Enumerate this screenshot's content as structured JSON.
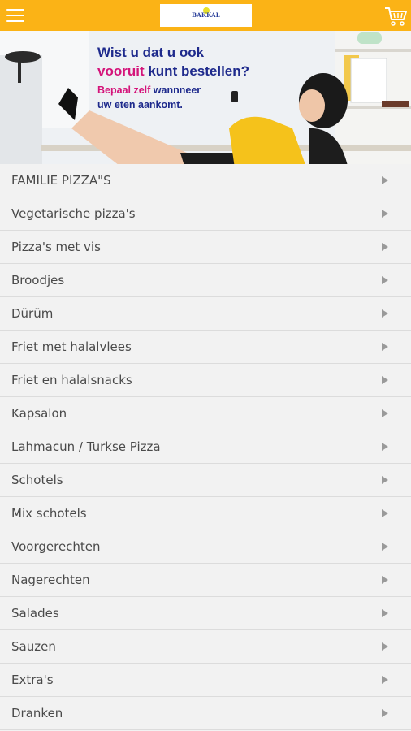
{
  "header": {
    "menu_icon": "hamburger-menu-icon",
    "logo_text": "BAKKAL",
    "cart_icon": "shopping-cart-icon",
    "background_color": "#fbb316"
  },
  "banner": {
    "line1": "Wist u dat u ook",
    "line2_part1": "vooruit",
    "line2_part2": "kunt bestellen?",
    "line3_part1": "Bepaal zelf",
    "line3_part2": "wannneer",
    "line4": "uw eten aankomt.",
    "accent_pink": "#d4147a",
    "accent_blue": "#1e2a8c"
  },
  "categories": [
    "FAMILIE PIZZA\"S",
    "Vegetarische pizza's",
    "Pizza's met vis",
    "Broodjes",
    "Dürüm",
    "Friet met halalvlees",
    "Friet en halalsnacks",
    "Kapsalon",
    "Lahmacun / Turkse Pizza",
    "Schotels",
    "Mix schotels",
    "Voorgerechten",
    "Nagerechten",
    "Salades",
    "Sauzen",
    "Extra's",
    "Dranken"
  ]
}
